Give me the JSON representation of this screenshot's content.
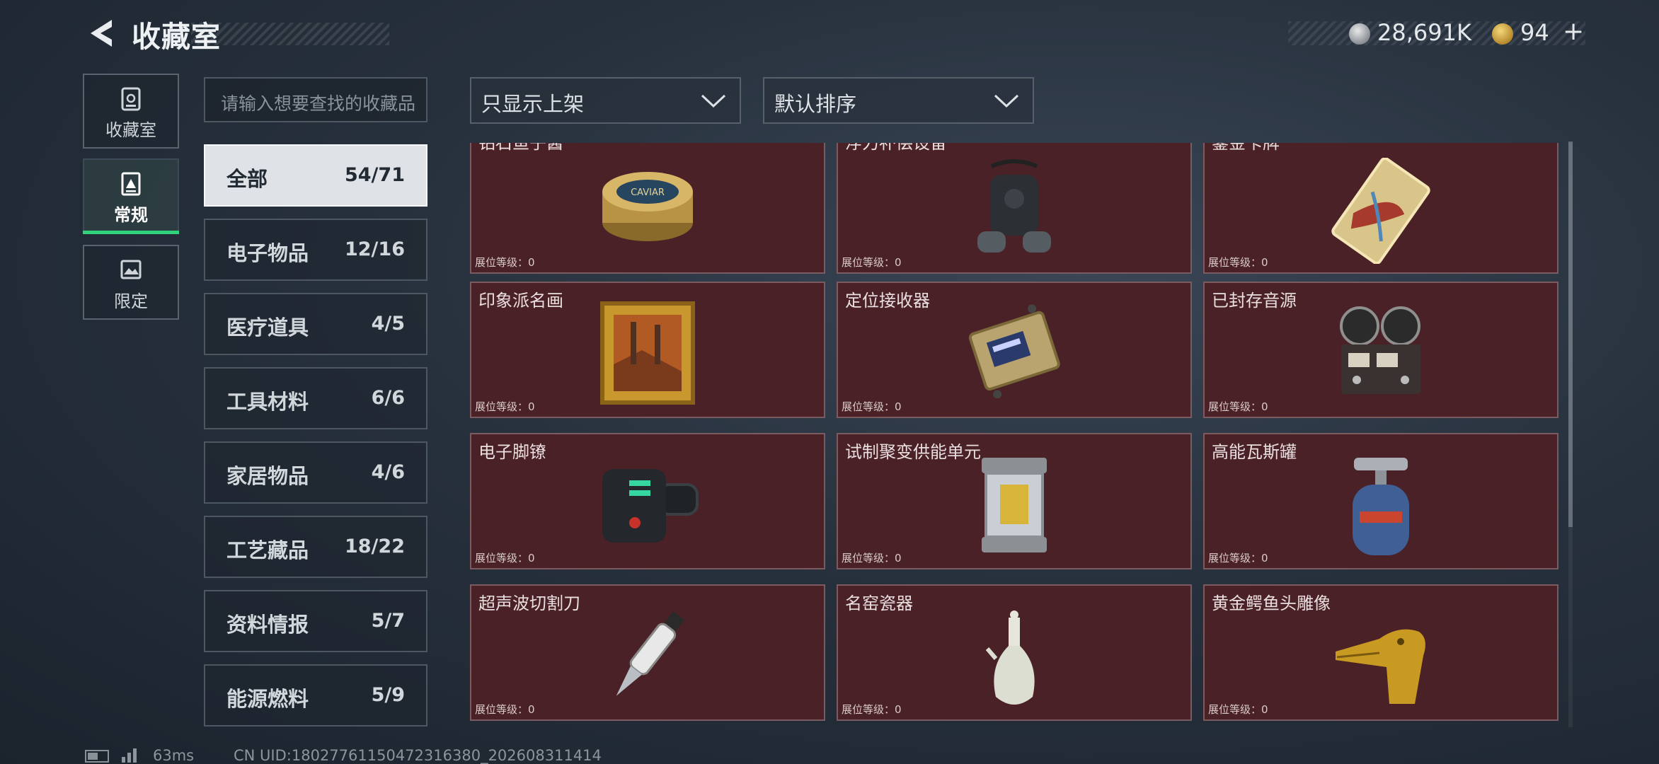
{
  "header": {
    "title": "收藏室",
    "money": "28,691K",
    "gems": "94",
    "plus": "+"
  },
  "nav": {
    "collection": "收藏室",
    "normal": "常规",
    "limited": "限定"
  },
  "search": {
    "placeholder": "请输入想要查找的收藏品"
  },
  "filters": {
    "show": "只显示上架",
    "sort": "默认排序"
  },
  "categories": [
    {
      "name": "全部",
      "count": "54/71"
    },
    {
      "name": "电子物品",
      "count": "12/16"
    },
    {
      "name": "医疗道具",
      "count": "4/5"
    },
    {
      "name": "工具材料",
      "count": "6/6"
    },
    {
      "name": "家居物品",
      "count": "4/6"
    },
    {
      "name": "工艺藏品",
      "count": "18/22"
    },
    {
      "name": "资料情报",
      "count": "5/7"
    },
    {
      "name": "能源燃料",
      "count": "5/9"
    }
  ],
  "items": [
    {
      "name": "钻石鱼子酱",
      "level": "展位等级：0",
      "icon": "caviar-tin-icon"
    },
    {
      "name": "浮力补偿设备",
      "level": "展位等级：0",
      "icon": "buoyancy-device-icon"
    },
    {
      "name": "鎏金卡牌",
      "level": "展位等级：0",
      "icon": "gilded-card-icon"
    },
    {
      "name": "印象派名画",
      "level": "展位等级：0",
      "icon": "framed-painting-icon"
    },
    {
      "name": "定位接收器",
      "level": "展位等级：0",
      "icon": "locator-receiver-icon"
    },
    {
      "name": "已封存音源",
      "level": "展位等级：0",
      "icon": "reel-recorder-icon"
    },
    {
      "name": "电子脚镣",
      "level": "展位等级：0",
      "icon": "ankle-monitor-icon"
    },
    {
      "name": "试制聚变供能单元",
      "level": "展位等级：0",
      "icon": "fusion-cell-icon"
    },
    {
      "name": "高能瓦斯罐",
      "level": "展位等级：0",
      "icon": "gas-canister-icon"
    },
    {
      "name": "超声波切割刀",
      "level": "展位等级：0",
      "icon": "ultrasonic-knife-icon"
    },
    {
      "name": "名窑瓷器",
      "level": "展位等级：0",
      "icon": "porcelain-vase-icon"
    },
    {
      "name": "黄金鳄鱼头雕像",
      "level": "展位等级：0",
      "icon": "gold-crocodile-icon"
    }
  ],
  "status": {
    "ping": "63ms",
    "uid": "CN UID:180277611504723163​80_202608311414"
  },
  "colors": {
    "card_bg": "#4a2126",
    "active_indicator": "#30d27b"
  }
}
